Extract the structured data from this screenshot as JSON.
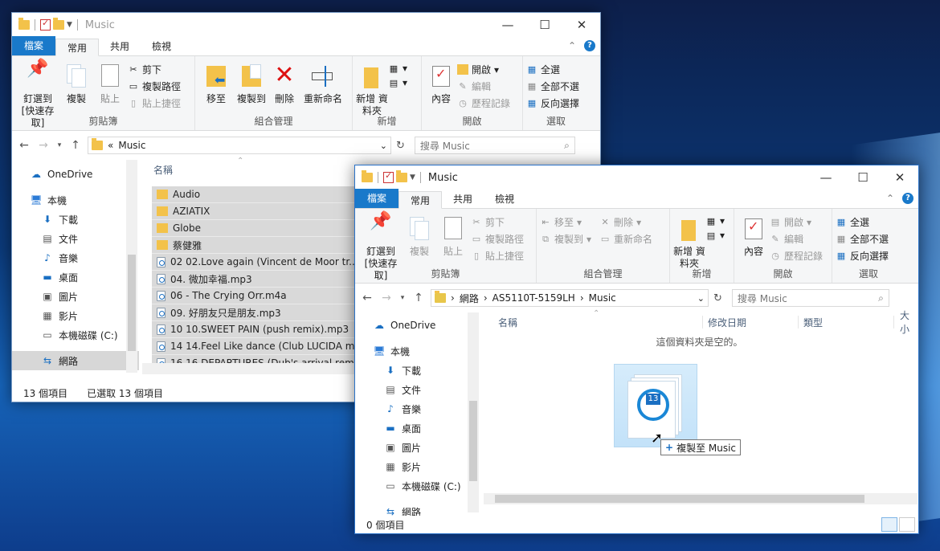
{
  "desktop": {
    "accent": "#1979ca"
  },
  "back_window": {
    "title": "Music",
    "tabs": {
      "file": "檔案",
      "home": "常用",
      "share": "共用",
      "view": "檢視"
    },
    "ribbon": {
      "pin": "釘選到 [快速存取]",
      "copy": "複製",
      "paste": "貼上",
      "cut": "剪下",
      "copy_path": "複製路徑",
      "paste_shortcut": "貼上捷徑",
      "clipboard": "剪貼簿",
      "move_to": "移至",
      "copy_to": "複製到",
      "delete": "刪除",
      "rename": "重新命名",
      "organize": "組合管理",
      "new_folder": "新增 資料夾",
      "new": "新增",
      "properties": "內容",
      "open": "開啟",
      "edit": "編輯",
      "history": "歷程記錄",
      "open_group": "開啟",
      "select_all": "全選",
      "select_none": "全部不選",
      "invert": "反向選擇",
      "select": "選取"
    },
    "address": {
      "prefix": "«",
      "path": "Music"
    },
    "search_placeholder": "搜尋 Music",
    "nav": [
      "OneDrive",
      "本機",
      "下載",
      "文件",
      "音樂",
      "桌面",
      "圖片",
      "影片",
      "本機磁碟 (C:)",
      "網路"
    ],
    "column_name": "名稱",
    "files": [
      {
        "name": "Audio",
        "type": "folder"
      },
      {
        "name": "AZIATIX",
        "type": "folder"
      },
      {
        "name": "Globe",
        "type": "folder"
      },
      {
        "name": "蔡健雅",
        "type": "folder"
      },
      {
        "name": "02 02.Love again (Vincent de Moor tr....",
        "type": "audio"
      },
      {
        "name": "04. 微加幸福.mp3",
        "type": "audio"
      },
      {
        "name": "06 - The Crying Orr.m4a",
        "type": "audio"
      },
      {
        "name": "09. 好朋友只是朋友.mp3",
        "type": "audio"
      },
      {
        "name": "10 10.SWEET PAIN (push remix).mp3",
        "type": "audio"
      },
      {
        "name": "14 14.Feel Like dance (Club LUCIDA m....",
        "type": "audio"
      },
      {
        "name": "16 16.DEPARTURES (Dub's arrival remi....",
        "type": "audio"
      }
    ],
    "status": {
      "count": "13 個項目",
      "selected": "已選取 13 個項目"
    }
  },
  "front_window": {
    "title": "Music",
    "tabs": {
      "file": "檔案",
      "home": "常用",
      "share": "共用",
      "view": "檢視"
    },
    "ribbon": {
      "pin": "釘選到 [快速存取]",
      "copy": "複製",
      "paste": "貼上",
      "cut": "剪下",
      "copy_path": "複製路徑",
      "paste_shortcut": "貼上捷徑",
      "clipboard": "剪貼簿",
      "move_to": "移至",
      "copy_to": "複製到",
      "delete": "刪除",
      "rename": "重新命名",
      "organize": "組合管理",
      "new_folder": "新增 資料夾",
      "new": "新增",
      "properties": "內容",
      "open": "開啟",
      "edit": "編輯",
      "history": "歷程記錄",
      "open_group": "開啟",
      "select_all": "全選",
      "select_none": "全部不選",
      "invert": "反向選擇",
      "select": "選取"
    },
    "address": {
      "seg1": "網路",
      "seg2": "AS5110T-5159LH",
      "seg3": "Music"
    },
    "search_placeholder": "搜尋 Music",
    "nav": [
      "OneDrive",
      "本機",
      "下載",
      "文件",
      "音樂",
      "桌面",
      "圖片",
      "影片",
      "本機磁碟 (C:)",
      "網路"
    ],
    "columns": {
      "name": "名稱",
      "modified": "修改日期",
      "type": "類型",
      "size": "大小"
    },
    "empty_text": "這個資料夾是空的。",
    "drag": {
      "count": "13",
      "tooltip": "複製至 Music"
    },
    "status": {
      "count": "0 個項目"
    }
  }
}
